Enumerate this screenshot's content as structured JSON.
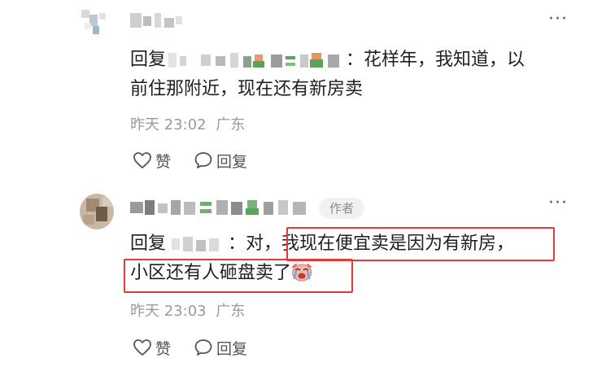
{
  "comments": [
    {
      "reply_prefix": "回复",
      "text_line1": "：花样年，我知道，以",
      "text_line2": "前住那附近，现在还有新房卖",
      "time": "昨天 23:02",
      "location": "广东",
      "like_label": "赞",
      "reply_label": "回复"
    },
    {
      "author_badge": "作者",
      "reply_prefix": "回复",
      "text_line1_a": "：对，",
      "text_line1_b": "我现在便宜卖是因为有新房，",
      "text_line2": "小区还有人砸盘卖了",
      "time": "昨天 23:03",
      "location": "广东",
      "like_label": "赞",
      "reply_label": "回复"
    }
  ],
  "icons": {
    "more": "more-dots-icon",
    "like": "heart-icon",
    "reply": "speech-bubble-icon",
    "emoji": "crying-face-emoji-icon"
  },
  "colors": {
    "highlight": "#e53935",
    "meta_text": "#9a9a9a",
    "badge_bg": "#f1f1f1"
  }
}
